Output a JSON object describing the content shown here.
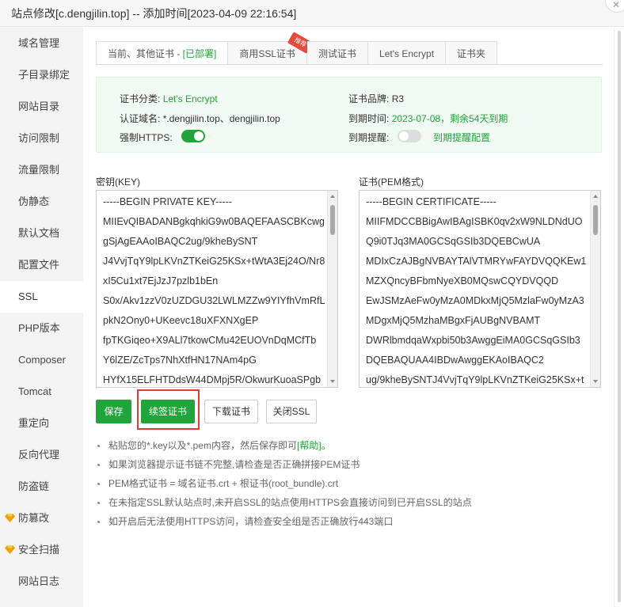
{
  "window": {
    "title": "站点修改[c.dengjilin.top] -- 添加时间[2023-04-09 22:16:54]"
  },
  "sidebar": {
    "items": [
      {
        "label": "域名管理",
        "gem": false,
        "active": false
      },
      {
        "label": "子目录绑定",
        "gem": false,
        "active": false
      },
      {
        "label": "网站目录",
        "gem": false,
        "active": false
      },
      {
        "label": "访问限制",
        "gem": false,
        "active": false
      },
      {
        "label": "流量限制",
        "gem": false,
        "active": false
      },
      {
        "label": "伪静态",
        "gem": false,
        "active": false
      },
      {
        "label": "默认文档",
        "gem": false,
        "active": false
      },
      {
        "label": "配置文件",
        "gem": false,
        "active": false
      },
      {
        "label": "SSL",
        "gem": false,
        "active": true
      },
      {
        "label": "PHP版本",
        "gem": false,
        "active": false
      },
      {
        "label": "Composer",
        "gem": false,
        "active": false
      },
      {
        "label": "Tomcat",
        "gem": false,
        "active": false
      },
      {
        "label": "重定向",
        "gem": false,
        "active": false
      },
      {
        "label": "反向代理",
        "gem": false,
        "active": false
      },
      {
        "label": "防盗链",
        "gem": false,
        "active": false
      },
      {
        "label": "防篡改",
        "gem": true,
        "active": false
      },
      {
        "label": "安全扫描",
        "gem": true,
        "active": false
      },
      {
        "label": "网站日志",
        "gem": false,
        "active": false
      }
    ],
    "gem_color": "#f0a100"
  },
  "tabs": [
    {
      "label": "当前、其他证书 - ",
      "status": "[已部署]"
    },
    {
      "label": "商用SSL证书",
      "badge": "推荐"
    },
    {
      "label": "测试证书"
    },
    {
      "label": "Let's Encrypt"
    },
    {
      "label": "证书夹"
    }
  ],
  "cert_info": {
    "category_label": "证书分类:",
    "category_value": "Let's Encrypt",
    "domain_label": "认证域名:",
    "domain_value": "*.dengjilin.top、dengjilin.top",
    "https_label": "强制HTTPS:",
    "brand_label": "证书品牌:",
    "brand_value": "R3",
    "expire_label": "到期时间:",
    "expire_value": "2023-07-08，剩余54天到期",
    "remind_label": "到期提醒:",
    "remind_value": "到期提醒配置",
    "force_https_on": true,
    "remind_on": false
  },
  "key_field": {
    "label": "密钥(KEY)",
    "lines": [
      "-----BEGIN PRIVATE KEY-----",
      "MIIEvQIBADANBgkqhkiG9w0BAQEFAASCBKcwg",
      "gSjAgEAAoIBAQC2ug/9kheBySNT",
      "J4VvjTqY9lpLKVnZTKeiG25KSx+tWtA3Ej24O/Nr8",
      "xI5Cu1xt7EjJzJ7pzlb1bEn",
      "S0x/Akv1zzV0zUZDGU32LWLMZZw9YIYfhVmRfL",
      "pkN2Ony0+UKeevc18uXFXNXgEP",
      "fpTKGiqeo+X9ALl7tkowCMu42EUOVnDqMCfTb",
      "Y6lZE/ZcTps7NhXtfHN17NAm4pG",
      "HYfX15ELFHTDdsW44DMpj5R/OkwurKuoaSPgb"
    ]
  },
  "cert_field": {
    "label": "证书(PEM格式)",
    "lines": [
      "-----BEGIN CERTIFICATE-----",
      "MIIFMDCCBBigAwIBAgISBK0qv2xW9NLDNdUO",
      "Q9i0TJq3MA0GCSqGSIb3DQEBCwUA",
      "MDIxCzAJBgNVBAYTAlVTMRYwFAYDVQQKEw1",
      "MZXQncyBFbmNyeXB0MQswCQYDVQQD",
      "EwJSMzAeFw0yMzA0MDkxMjQ5MzlaFw0yMzA3",
      "MDgxMjQ5MzhaMBgxFjAUBgNVBAMT",
      "DWRlbmdqaWxpbi50b3AwggEiMA0GCSqGSIb3",
      "DQEBAQUAA4IBDwAwggEKAoIBAQC2",
      "ug/9kheBySNTJ4VvjTqY9lpLKVnZTKeiG25KSx+t"
    ]
  },
  "buttons": {
    "save": "保存",
    "renew": "续签证书",
    "download": "下载证书",
    "close_ssl": "关闭SSL"
  },
  "tips": {
    "tip1_text": "粘贴您的*.key以及*.pem内容，然后保存即可",
    "tip1_link": "[帮助]",
    "tip1_end": "。",
    "tip2": "如果浏览器提示证书链不完整,请检查是否正确拼接PEM证书",
    "tip3": "PEM格式证书 = 域名证书.crt + 根证书(root_bundle).crt",
    "tip4": "在未指定SSL默认站点时,未开启SSL的站点使用HTTPS会直接访问到已开启SSL的站点",
    "tip5": "如开启后无法使用HTTPS访问，请检查安全组是否正确放行443端口"
  },
  "colors": {
    "accent": "#20a53a",
    "highlight": "#e53935",
    "badge": "#e84a3c"
  }
}
